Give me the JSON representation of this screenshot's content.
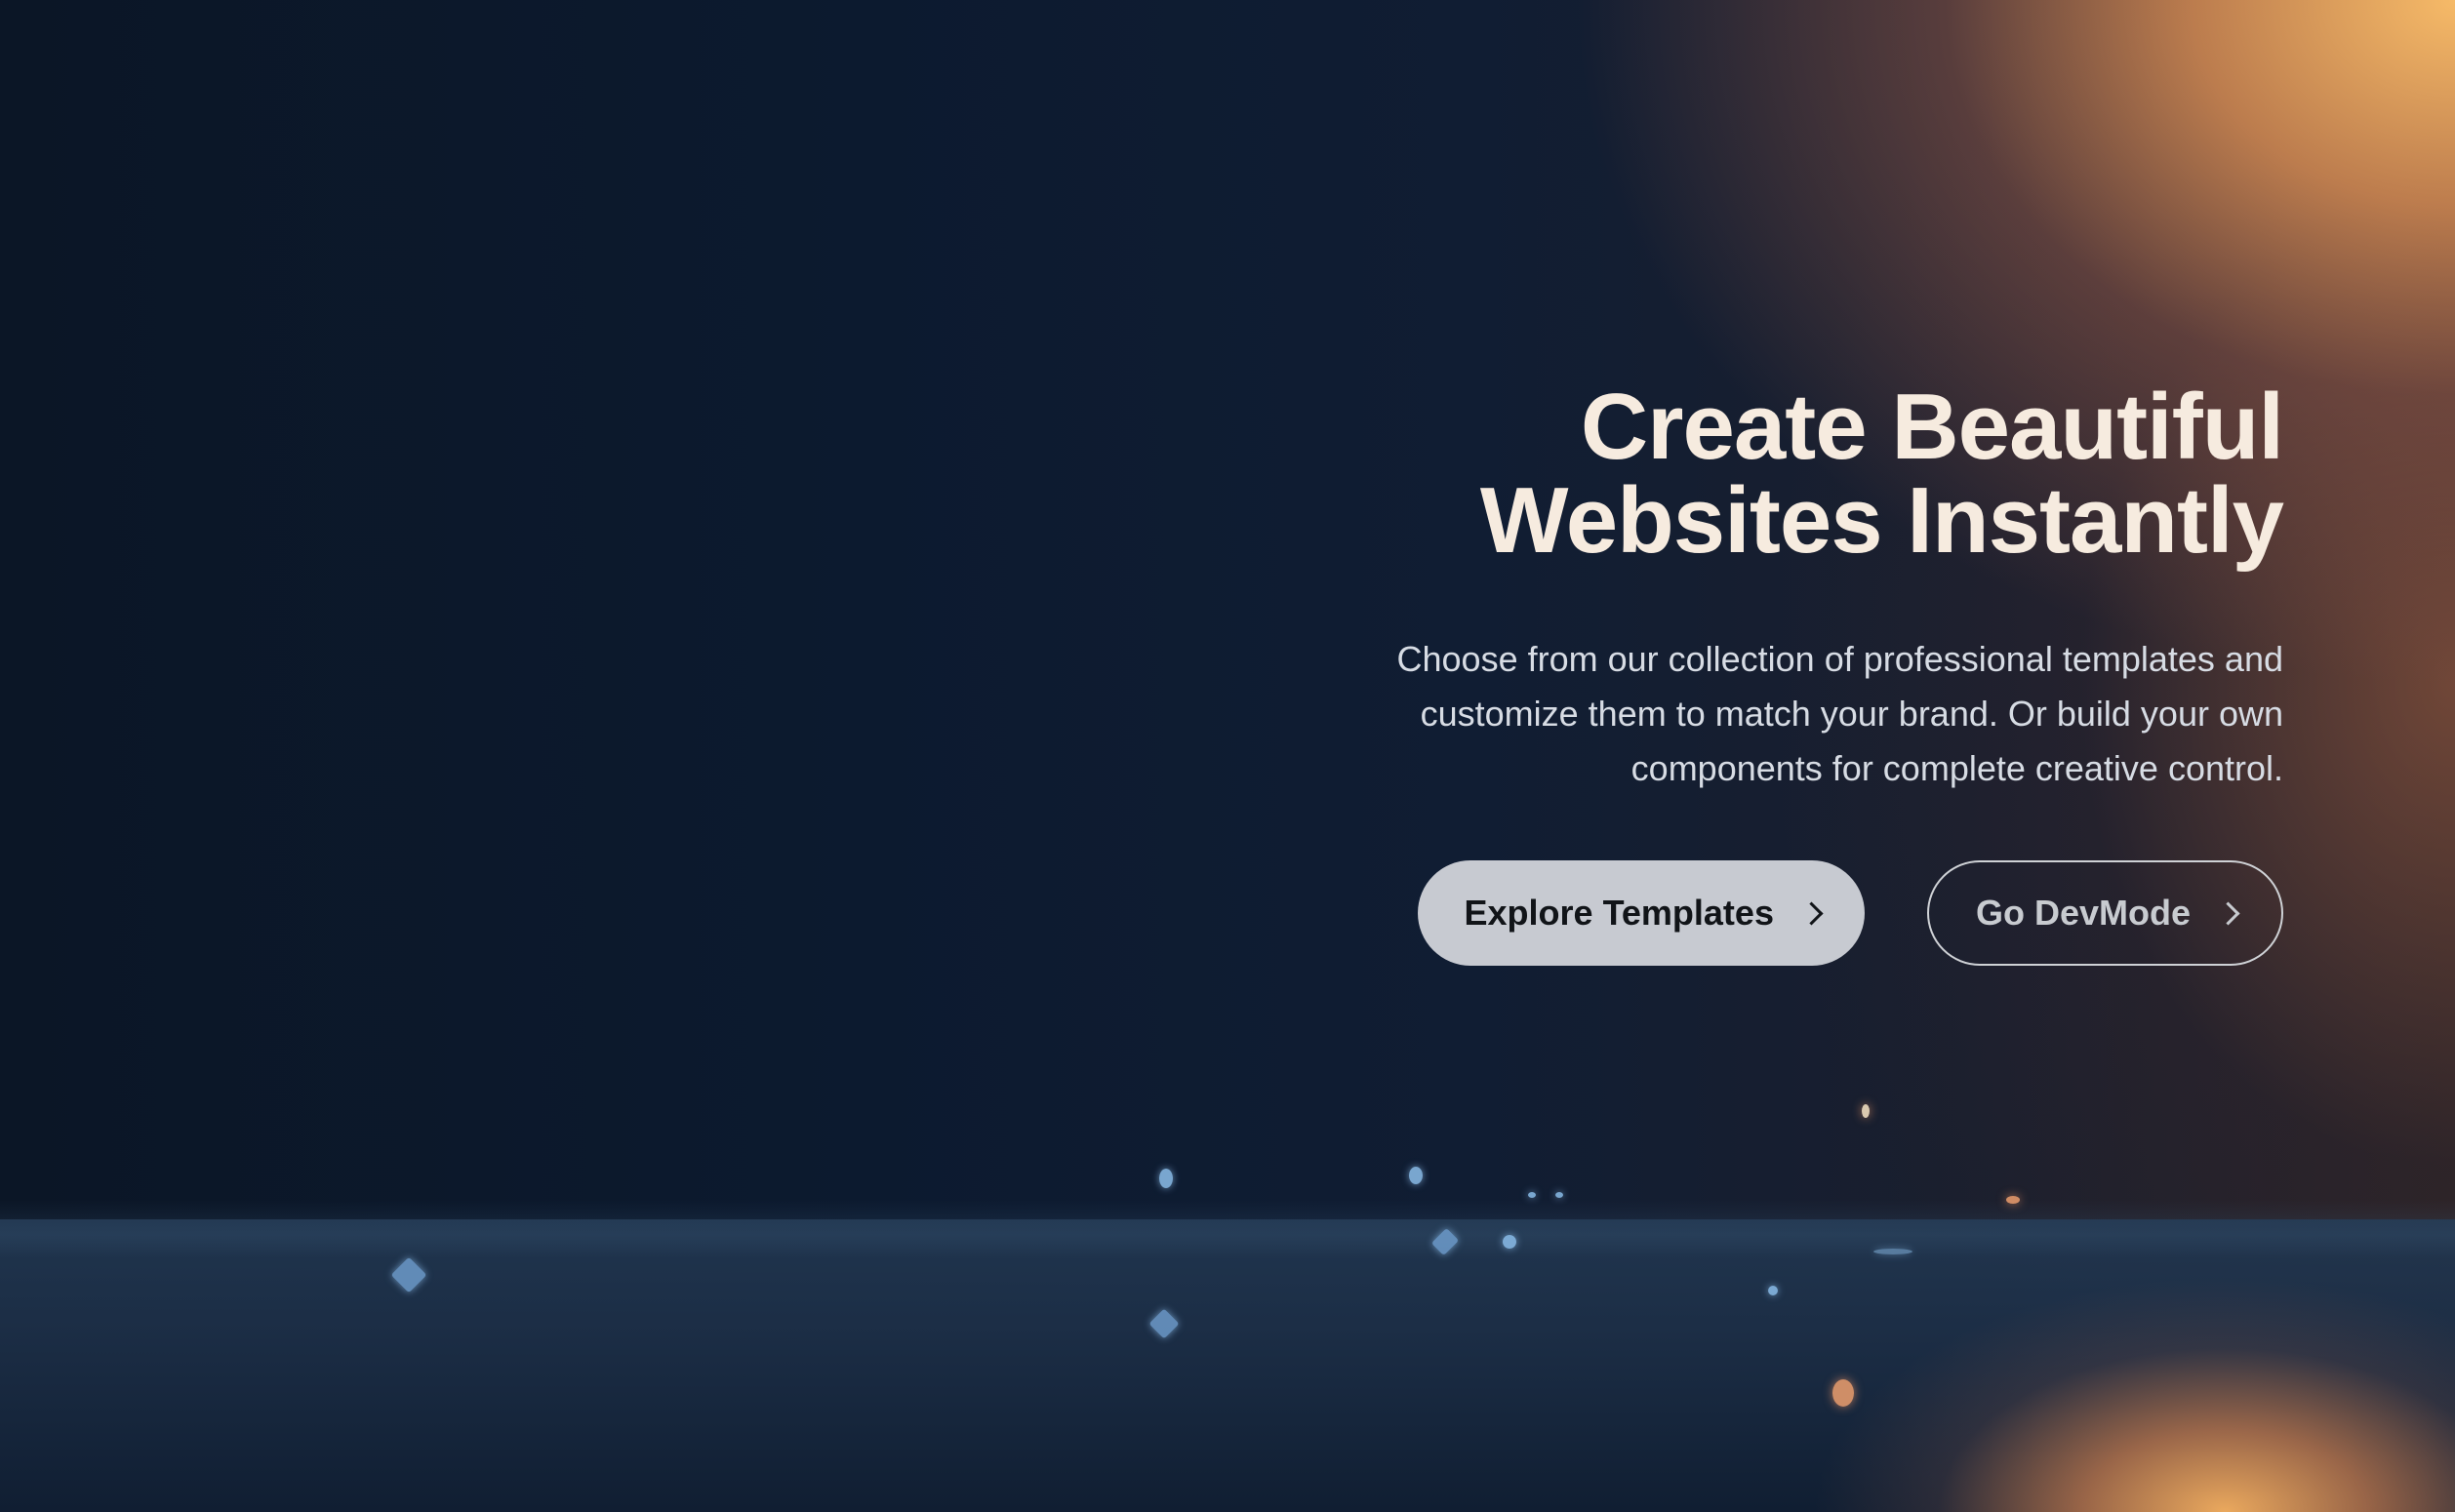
{
  "hero": {
    "title_line1": "Create Beautiful",
    "title_line2": "Websites Instantly",
    "subtitle": "Choose from our collection of professional templates and customize them to match your brand. Or build your own components for complete creative control.",
    "primary_button": {
      "label": "Explore Templates",
      "icon": "chevron-right-icon"
    },
    "secondary_button": {
      "label": "Go DevMode",
      "icon": "chevron-right-icon"
    }
  },
  "colors": {
    "background_dark": "#0b1626",
    "glow_warm": "#f6ba68",
    "title": "#f6ebdf",
    "subtitle": "#d7dce4",
    "primary_button_bg": "#c7cad1",
    "secondary_button_border": "#cfd2d6"
  }
}
